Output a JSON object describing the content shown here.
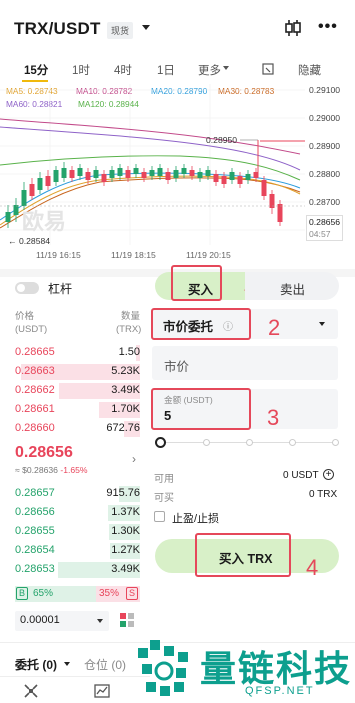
{
  "header": {
    "pair": "TRX/USDT",
    "market_tag": "现货"
  },
  "timeframes": [
    "15分",
    "1时",
    "4时",
    "1日",
    "更多",
    "隐藏"
  ],
  "ma": {
    "ma5": "MA5: 0.28743",
    "ma10": "MA10: 0.28782",
    "ma20": "MA20: 0.28790",
    "ma30": "MA30: 0.28783",
    "ma60": "MA60: 0.28821",
    "ma120": "MA120: 0.28944"
  },
  "chart": {
    "price_ticks": [
      "0.29100",
      "0.29000",
      "0.28900",
      "0.28800",
      "0.28700"
    ],
    "high_label": "0.28950",
    "low_label": "← 0.28584",
    "current_price": "0.28656",
    "countdown": "04:57",
    "time_labels": [
      "11/19 16:15",
      "11/19 18:15",
      "11/19 20:15"
    ],
    "watermark": "欧易",
    "colors": {
      "ma5": "#e0a12b",
      "ma10": "#c24a8a",
      "ma20": "#2d9ddb",
      "ma30": "#c8651e",
      "ma60": "#8e62c8",
      "ma120": "#59b24a",
      "up": "#24a36b",
      "down": "#e8455b"
    }
  },
  "leverage": {
    "label": "杠杆"
  },
  "orderbook": {
    "col_price": "价格",
    "col_price_unit": "(USDT)",
    "col_qty": "数量",
    "col_qty_unit": "(TRX)",
    "asks": [
      {
        "price": "0.28665",
        "qty": "1.50",
        "depth": 0.03
      },
      {
        "price": "0.28663",
        "qty": "5.23K",
        "depth": 0.95
      },
      {
        "price": "0.28662",
        "qty": "3.49K",
        "depth": 0.65
      },
      {
        "price": "0.28661",
        "qty": "1.70K",
        "depth": 0.33
      },
      {
        "price": "0.28660",
        "qty": "672.76",
        "depth": 0.13
      }
    ],
    "last_price": "0.28656",
    "last_sub": "≈ $0.28636",
    "last_change": "-1.65%",
    "bids": [
      {
        "price": "0.28657",
        "qty": "915.76",
        "depth": 0.17
      },
      {
        "price": "0.28656",
        "qty": "1.37K",
        "depth": 0.26
      },
      {
        "price": "0.28655",
        "qty": "1.30K",
        "depth": 0.25
      },
      {
        "price": "0.28654",
        "qty": "1.27K",
        "depth": 0.24
      },
      {
        "price": "0.28653",
        "qty": "3.49K",
        "depth": 0.66
      }
    ],
    "ratio_b": "B",
    "ratio_buy": "65%",
    "ratio_sell": "35%",
    "ratio_s": "S",
    "buy_fraction": 0.65,
    "precision": "0.00001"
  },
  "trade": {
    "buy_tab": "买入",
    "sell_tab": "卖出",
    "order_type": "市价委托",
    "order_type_info": "ⓘ",
    "price_field": "市价",
    "amount_label": "金额 (USDT)",
    "amount_value": "5",
    "available_label": "可用",
    "available_value": "0 USDT",
    "buyable_label": "可买",
    "buyable_value": "0 TRX",
    "tpsl_label": "止盈/止损",
    "submit": "买入 TRX"
  },
  "annotations": [
    "1",
    "2",
    "3",
    "4"
  ],
  "bottom": {
    "orders_tab": "委托 (0)",
    "position_tab": "仓位 (0)"
  },
  "brand": {
    "name": "量链科技",
    "site": "QFSP.NET"
  }
}
